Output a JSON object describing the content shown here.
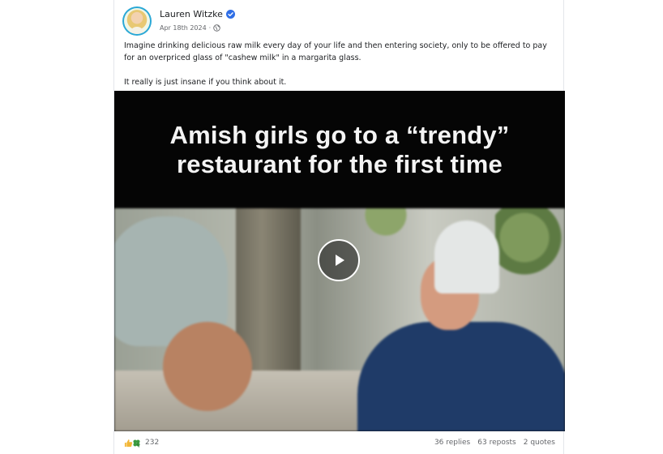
{
  "post": {
    "author": "Lauren Witzke",
    "verified": true,
    "date": "Apr 18th 2024",
    "separator": "·",
    "audience_icon": "globe-icon",
    "body": [
      "Imagine drinking delicious raw milk every day of your life and then entering society, only to be offered to pay for an overpriced glass of \"cashew milk\" in a margarita glass.",
      "It really is just insane if you think about it."
    ]
  },
  "video": {
    "caption_line1": "Amish girls go to a “trendy”",
    "caption_line2": "restaurant for the first time",
    "play_icon": "play-icon"
  },
  "footer": {
    "reaction_icons": [
      "thumbs-up-icon",
      "clover-icon"
    ],
    "like_count": "232",
    "replies": "36 replies",
    "reposts": "63 reposts",
    "quotes": "2 quotes"
  },
  "colors": {
    "verified_blue": "#2f6ee6",
    "text_primary": "#1c1e21",
    "text_secondary": "#65676b",
    "like_yellow": "#f2b636",
    "clover_green": "#3a9a3f"
  }
}
